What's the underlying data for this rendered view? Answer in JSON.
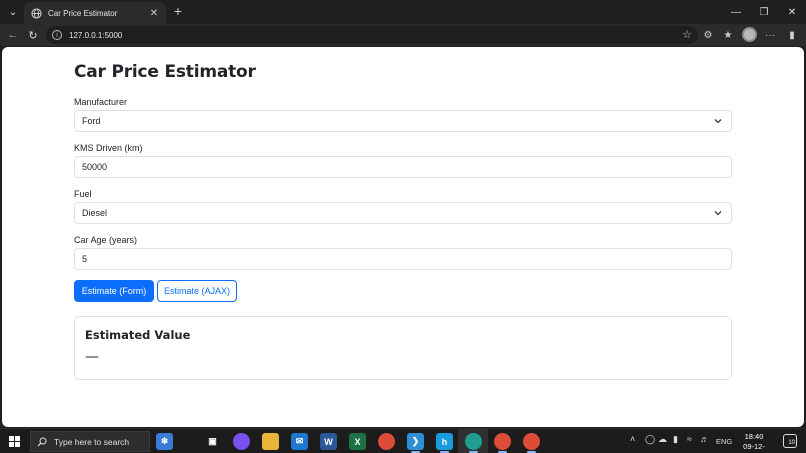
{
  "browser": {
    "tab_title": "Car Price Estimator",
    "url": "127.0.0.1:5000"
  },
  "page": {
    "title": "Car Price Estimator",
    "manufacturer": {
      "label": "Manufacturer",
      "value": "Ford"
    },
    "kms": {
      "label": "KMS Driven (km)",
      "value": "50000"
    },
    "fuel": {
      "label": "Fuel",
      "value": "Diesel"
    },
    "age": {
      "label": "Car Age (years)",
      "value": "5"
    },
    "buttons": {
      "form": "Estimate (Form)",
      "ajax": "Estimate (AJAX)"
    },
    "result": {
      "title": "Estimated Value",
      "value": "—"
    }
  },
  "taskbar": {
    "search_placeholder": "Type here to search",
    "language": "ENG",
    "time": "18:40",
    "date": "09-12-2025",
    "notification_count": "10"
  },
  "colors": {
    "primary": "#0d6efd",
    "text": "#212529",
    "border": "#dee2e6"
  },
  "icons": [
    "tab-menu-icon",
    "globe-icon",
    "close-icon",
    "plus-icon",
    "minimize-icon",
    "maximize-icon",
    "back-icon",
    "reload-icon",
    "info-icon",
    "star-icon",
    "chevron-down-icon",
    "windows-icon",
    "search-icon"
  ]
}
